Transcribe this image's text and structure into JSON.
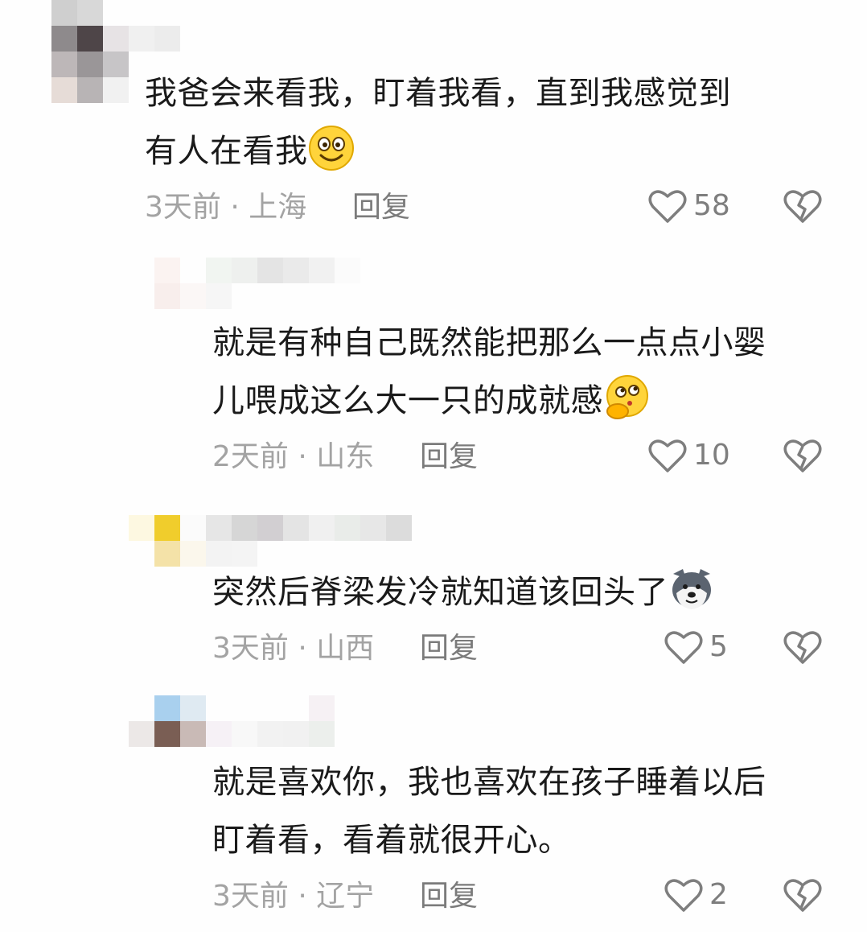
{
  "comments": [
    {
      "text_line1": "我爸会来看我，盯着我看，直到我感觉到",
      "text_line2": "有人在看我",
      "emoji": "smiling-face-emoji",
      "time_location": "3天前 · 上海",
      "reply_label": "回复",
      "likes": "58"
    },
    {
      "text_line1": "就是有种自己既然能把那么一点点小婴",
      "text_line2": "儿喂成这么大一只的成就感",
      "emoji": "thinking-face-emoji",
      "time_location": "2天前 · 山东",
      "reply_label": "回复",
      "likes": "10"
    },
    {
      "text_line1": "突然后脊梁发冷就知道该回头了",
      "emoji": "husky-dog-emoji",
      "time_location": "3天前 · 山西",
      "reply_label": "回复",
      "likes": "5"
    },
    {
      "text_line1": "就是喜欢你，我也喜欢在孩子睡着以后",
      "text_line2": "盯着看，看着就很开心。",
      "time_location": "3天前 · 辽宁",
      "reply_label": "回复",
      "likes": "2"
    }
  ],
  "icons": {
    "like": "heart-outline-icon",
    "dislike": "broken-heart-icon"
  },
  "colors": {
    "text": "#1a1a1a",
    "meta": "#a3a3a3",
    "icon": "#7e7e7e"
  }
}
